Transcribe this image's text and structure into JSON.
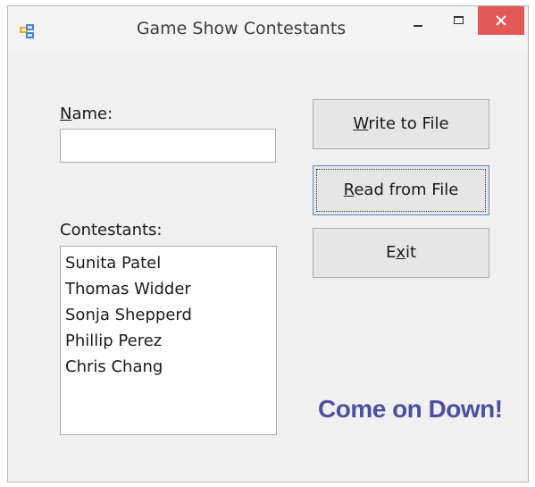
{
  "window": {
    "title": "Game Show Contestants",
    "icon": "app-window-icon"
  },
  "form": {
    "name_label_accel": "N",
    "name_label_rest": "ame:",
    "name_value": "",
    "contestants_label": "Contestants:",
    "contestants": [
      "Sunita Patel",
      "Thomas Widder",
      "Sonja Shepperd",
      "Phillip Perez",
      "Chris Chang"
    ]
  },
  "buttons": {
    "write_accel": "W",
    "write_rest": "rite to File",
    "read_accel": "R",
    "read_rest": "ead from File",
    "exit_pre": "E",
    "exit_accel": "x",
    "exit_post": "it"
  },
  "slogan": "Come on Down!",
  "colors": {
    "slogan": "#4f4fa0",
    "close_button": "#e45757",
    "focus_border": "#5f87c9"
  }
}
